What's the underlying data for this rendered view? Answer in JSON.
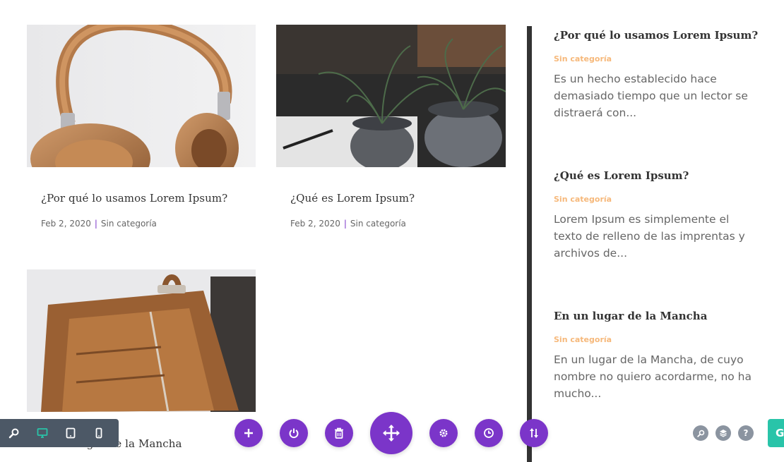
{
  "posts": [
    {
      "title": "¿Por qué lo usamos Lorem Ipsum?",
      "date": "Feb 2, 2020",
      "separator": "|",
      "category": "Sin categoría"
    },
    {
      "title": "¿Qué es Lorem Ipsum?",
      "date": "Feb 2, 2020",
      "separator": "|",
      "category": "Sin categoría"
    },
    {
      "title": "En un lugar de la Mancha"
    }
  ],
  "sidebar": {
    "posts": [
      {
        "title": "¿Por qué lo usamos Lorem Ipsum?",
        "category": "Sin categoría",
        "excerpt": "Es un hecho establecido hace demasiado tiempo que un lector se distraerá con..."
      },
      {
        "title": "¿Qué es Lorem Ipsum?",
        "category": "Sin categoría",
        "excerpt": "Lorem Ipsum es simplemente el texto de relleno de las imprentas y archivos de..."
      },
      {
        "title": "En un lugar de la Mancha",
        "category": "Sin categoría",
        "excerpt": "En un lugar de la Mancha, de cuyo nombre no quiero acordarme, no ha mucho..."
      }
    ]
  },
  "builder": {
    "view_modes": [
      "zoom-icon",
      "desktop-icon",
      "tablet-icon",
      "phone-icon"
    ],
    "actions": [
      "add-icon",
      "power-icon",
      "trash-icon",
      "move-icon",
      "settings-icon",
      "history-icon",
      "sort-icon"
    ],
    "right_tools": [
      "search-icon",
      "layers-icon",
      "help-icon"
    ],
    "help_label": "?",
    "save_label": "G"
  },
  "colors": {
    "accent": "#7b35c9",
    "category": "#f6b87a",
    "viewbar": "#4c5866",
    "save": "#29c4a9",
    "active_view": "#29c4a9"
  }
}
